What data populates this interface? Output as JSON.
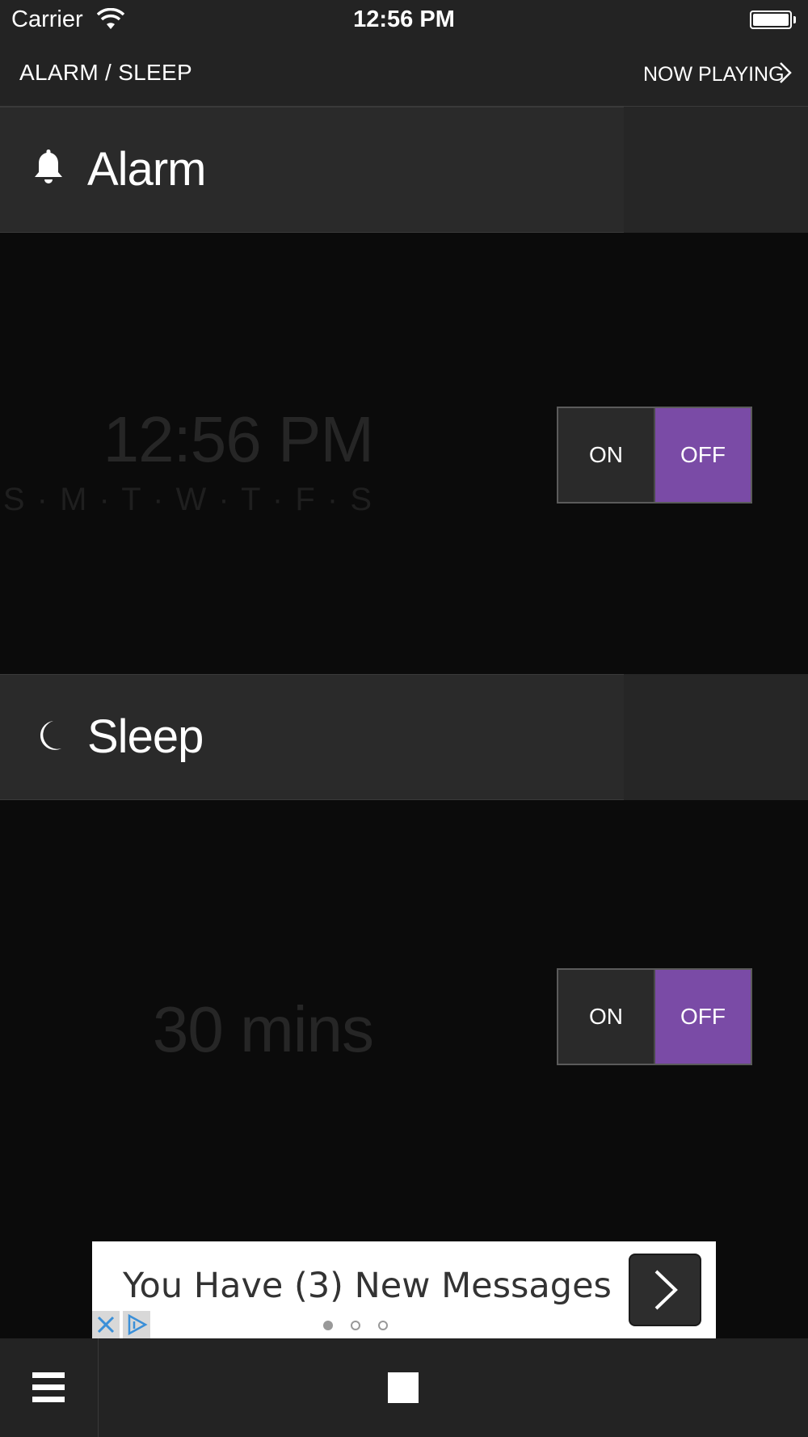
{
  "status_bar": {
    "carrier": "Carrier",
    "time": "12:56 PM",
    "wifi_icon": "wifi-icon",
    "battery_icon": "battery-icon"
  },
  "nav": {
    "title": "ALARM / SLEEP",
    "now_playing": "NOW PLAYING"
  },
  "alarm": {
    "title": "Alarm",
    "icon": "bell-icon",
    "time": "12:56 PM",
    "days": "S · M · T · W · T · F · S",
    "toggle": {
      "on_label": "ON",
      "off_label": "OFF",
      "state": "off"
    }
  },
  "sleep": {
    "title": "Sleep",
    "icon": "moon-icon",
    "duration": "30 mins",
    "toggle": {
      "on_label": "ON",
      "off_label": "OFF",
      "state": "off"
    }
  },
  "ad": {
    "text": "You Have (3) New Messages",
    "close_icon": "close-icon",
    "info_icon": "adchoices-icon"
  },
  "bottom_bar": {
    "menu_icon": "menu-icon",
    "stop_icon": "stop-icon"
  },
  "colors": {
    "accent": "#7a4ba6",
    "background": "#0b0b0b",
    "header": "#2a2a2a"
  }
}
